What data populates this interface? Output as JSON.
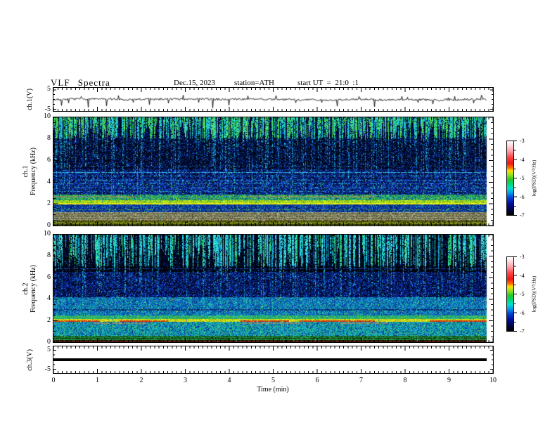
{
  "header": {
    "title": "VLF Spectra",
    "date": "Dec.15, 2023",
    "station": "station=ATH",
    "start_ut": "start UT  =  21:0  :1"
  },
  "axis": {
    "xlabel": "Time (min)",
    "xlim": [
      0,
      10
    ],
    "xticks": [
      "0",
      "1",
      "2",
      "3",
      "4",
      "5",
      "6",
      "7",
      "8",
      "9",
      "10"
    ]
  },
  "colorbar": {
    "label": "log(PSD)(V²/Hz)",
    "ticks": [
      "-3",
      "-4",
      "-5",
      "-6",
      "-7"
    ],
    "range": [
      -3,
      -7
    ],
    "gradient": [
      {
        "c": "#ffffff",
        "p": 0
      },
      {
        "c": "#ffd8dc",
        "p": 6
      },
      {
        "c": "#ff9aa2",
        "p": 14
      },
      {
        "c": "#ff4040",
        "p": 22
      },
      {
        "c": "#f01818",
        "p": 30
      },
      {
        "c": "#ff7000",
        "p": 36
      },
      {
        "c": "#ffe000",
        "p": 40
      },
      {
        "c": "#90e020",
        "p": 46
      },
      {
        "c": "#28c828",
        "p": 52
      },
      {
        "c": "#00d878",
        "p": 58
      },
      {
        "c": "#00e0d0",
        "p": 64
      },
      {
        "c": "#00a0e8",
        "p": 70
      },
      {
        "c": "#0048d8",
        "p": 76
      },
      {
        "c": "#0010a0",
        "p": 84
      },
      {
        "c": "#000450",
        "p": 92
      },
      {
        "c": "#000000",
        "p": 100
      }
    ]
  },
  "chart_data": [
    {
      "id": "ch1-waveform",
      "type": "line",
      "ylabel": "ch.1(V)",
      "ylim": [
        -5,
        5
      ],
      "ytick_labels": [
        "5",
        "-5"
      ],
      "seed": 7,
      "noise_amp": 0.5,
      "data_end_min": 9.86,
      "spikes": [
        [
          0.18,
          -3.2
        ],
        [
          0.34,
          -1.8
        ],
        [
          0.62,
          1.5
        ],
        [
          0.78,
          -4.1
        ],
        [
          1.2,
          -3.4
        ],
        [
          1.47,
          2.0
        ],
        [
          1.8,
          -1.5
        ],
        [
          2.18,
          -2.7
        ],
        [
          2.6,
          -1.9
        ],
        [
          2.95,
          2.2
        ],
        [
          3.3,
          -1.6
        ],
        [
          3.62,
          -4.4
        ],
        [
          3.98,
          -3.1
        ],
        [
          4.42,
          1.8
        ],
        [
          5.05,
          2.0
        ],
        [
          5.5,
          -1.7
        ],
        [
          6.1,
          -1.6
        ],
        [
          6.45,
          -3.5
        ],
        [
          6.95,
          1.5
        ],
        [
          7.3,
          -3.8
        ],
        [
          7.92,
          1.6
        ],
        [
          8.28,
          -1.6
        ],
        [
          8.62,
          -2.4
        ],
        [
          9.12,
          1.6
        ],
        [
          9.55,
          -1.9
        ],
        [
          9.72,
          2.2
        ]
      ]
    },
    {
      "id": "ch1-spectrogram",
      "type": "heatmap",
      "ylabel_line1": "ch.1",
      "ylabel_line2": "Frequency (kHz)",
      "ylim": [
        0,
        10
      ],
      "yticks": [
        "0",
        "2",
        "4",
        "6",
        "8",
        "10"
      ],
      "seed": 42,
      "sferic": {
        "lo": 8.1,
        "density": 0.8,
        "ragged": 1.7,
        "deep_prob": 0.5,
        "penetration": 6.0,
        "full_prob": 0.03,
        "strength": 0.82,
        "palette": [
          "#27c24e",
          "#4ada52",
          "#67e63e",
          "#2bd0bc",
          "#22b2e2",
          "#35e08e",
          "#19c8e8"
        ],
        "pen_palette": [
          "#1b8cc8",
          "#18a6bc",
          "#0e54b4",
          "#2ad2d2"
        ]
      },
      "bands": [
        {
          "hi": 10.01,
          "lo": 8.1,
          "palette": [
            [
              "#000418",
              10
            ],
            [
              "#04156a",
              4
            ],
            [
              "#0a2fa8",
              2
            ],
            [
              "#1244cc",
              1
            ]
          ]
        },
        {
          "hi": 8.1,
          "lo": 5.2,
          "palette": [
            [
              "#000616",
              11
            ],
            [
              "#031252",
              5
            ],
            [
              "#0a2fa8",
              2
            ],
            [
              "#1e56d8",
              1
            ],
            [
              "#17a0c0",
              0.35
            ]
          ]
        },
        {
          "hi": 5.2,
          "lo": 4.3,
          "palette": [
            [
              "#021048",
              7
            ],
            [
              "#0a2fae",
              5
            ],
            [
              "#1e50d8",
              2.5
            ],
            [
              "#24a8cc",
              0.7
            ],
            [
              "#000414",
              4
            ]
          ]
        },
        {
          "hi": 4.3,
          "lo": 2.9,
          "palette": [
            [
              "#03175e",
              7
            ],
            [
              "#0d35bc",
              5
            ],
            [
              "#2258e0",
              2
            ],
            [
              "#22b0b0",
              0.8
            ],
            [
              "#2fc26a",
              0.4
            ],
            [
              "#000414",
              3
            ]
          ]
        },
        {
          "hi": 2.9,
          "lo": 2.35,
          "palette": [
            [
              "#1f9e4e",
              5
            ],
            [
              "#3fc04a",
              4
            ],
            [
              "#22ac96",
              3
            ],
            [
              "#8ccc2c",
              2
            ],
            [
              "#1468b4",
              2
            ],
            [
              "#0a2f90",
              1.5
            ]
          ]
        },
        {
          "hi": 2.35,
          "lo": 1.95,
          "palette": [
            [
              "#a6d414",
              6
            ],
            [
              "#c4e41e",
              4
            ],
            [
              "#7cc830",
              3
            ],
            [
              "#e4e400",
              1.5
            ],
            [
              "#3cb44c",
              2
            ]
          ]
        },
        {
          "hi": 1.95,
          "lo": 1.25,
          "palette": [
            [
              "#0b2f9e",
              6
            ],
            [
              "#1e50cc",
              4
            ],
            [
              "#1aa0bc",
              1.5
            ],
            [
              "#03103e",
              3
            ],
            [
              "#2fb860",
              0.5
            ]
          ]
        },
        {
          "hi": 1.25,
          "lo": 0.55,
          "palette": [
            [
              "#979770",
              8
            ],
            [
              "#a8a884",
              4
            ],
            [
              "#7c7c58",
              4
            ],
            [
              "#b4b494",
              2
            ],
            [
              "#5a5a3c",
              1.5
            ]
          ]
        },
        {
          "hi": 0.55,
          "lo": -0.01,
          "palette": [
            [
              "#15150c",
              9
            ],
            [
              "#2b2b12",
              3
            ],
            [
              "#3c440f",
              1
            ]
          ]
        }
      ],
      "hlines": [
        {
          "f": 5.55,
          "color": "#2a7cc8",
          "prob": 0.3
        },
        {
          "f": 4.95,
          "color": "#34b4da",
          "prob": 0.8
        },
        {
          "f": 4.6,
          "color": "#2fa8d4",
          "prob": 0.45
        },
        {
          "f": 4.25,
          "color": "#2fa8d4",
          "prob": 0.4
        },
        {
          "f": 3.9,
          "color": "#2fa8d4",
          "prob": 0.38
        },
        {
          "f": 3.52,
          "color": "#2fa8d4",
          "prob": 0.35
        },
        {
          "f": 3.17,
          "color": "#2fa8d4",
          "prob": 0.33
        },
        {
          "f": 2.7,
          "color": "#8e8e62",
          "prob": 0.75,
          "th": 2,
          "segs": [
            [
              0,
              1.85
            ],
            [
              4.3,
              7.3
            ]
          ]
        },
        {
          "f": 2.05,
          "color": "#e2ee16",
          "prob": 0.95,
          "th": 2
        },
        {
          "f": 1.52,
          "color": "#63b431",
          "prob": 0.4
        },
        {
          "f": 1.1,
          "color": "#3a3a22",
          "prob": 0.85
        },
        {
          "f": 0.9,
          "color": "#34341e",
          "prob": 0.85
        },
        {
          "f": 0.72,
          "color": "#42422a",
          "prob": 0.8
        },
        {
          "f": 0.52,
          "color": "#c24ec2",
          "prob": 0.2
        },
        {
          "f": 0.45,
          "color": "#b2ca16",
          "prob": 0.9
        },
        {
          "f": 0.3,
          "color": "#94aa12",
          "prob": 0.85
        },
        {
          "f": 0.18,
          "color": "#c2d41e",
          "prob": 0.9
        },
        {
          "f": 0.06,
          "color": "#6a7c0c",
          "prob": 0.9
        }
      ]
    },
    {
      "id": "ch2-spectrogram",
      "type": "heatmap",
      "ylabel_line1": "ch.2",
      "ylabel_line2": "Frequency (kHz)",
      "ylim": [
        0,
        10
      ],
      "yticks": [
        "0",
        "2",
        "4",
        "6",
        "8",
        "10"
      ],
      "seed": 1337,
      "sferic": {
        "lo": 7.1,
        "density": 0.55,
        "ragged": 2.0,
        "deep_prob": 0.45,
        "penetration": 5.5,
        "full_prob": 0.05,
        "strength": 0.85,
        "palette": [
          "#1fd2d2",
          "#3ce4e4",
          "#17a0dc",
          "#2de088",
          "#55eeee",
          "#18c8f0",
          "#2cc84e"
        ],
        "pen_palette": [
          "#17a0c8",
          "#14b4b4",
          "#0c50b4",
          "#27d2d2"
        ]
      },
      "bands": [
        {
          "hi": 10.01,
          "lo": 7.1,
          "palette": [
            [
              "#00030e",
              12
            ],
            [
              "#021048",
              3
            ],
            [
              "#0a2fa8",
              1.2
            ],
            [
              "#0c86c6",
              0.5
            ]
          ]
        },
        {
          "hi": 7.1,
          "lo": 6.6,
          "palette": [
            [
              "#000208",
              12
            ],
            [
              "#021048",
              2
            ],
            [
              "#0a2fa8",
              0.8
            ]
          ]
        },
        {
          "hi": 6.6,
          "lo": 4.2,
          "palette": [
            [
              "#020c3c",
              8
            ],
            [
              "#0a2aaa",
              5
            ],
            [
              "#1c4cd4",
              2
            ],
            [
              "#1c96cc",
              0.8
            ],
            [
              "#000310",
              4
            ]
          ]
        },
        {
          "hi": 4.2,
          "lo": 2.5,
          "palette": [
            [
              "#0f86c4",
              5
            ],
            [
              "#17a8ac",
              4
            ],
            [
              "#0b50bc",
              4
            ],
            [
              "#2cc488",
              1.5
            ],
            [
              "#0a2f8e",
              3
            ],
            [
              "#d4d41c",
              0.15
            ]
          ]
        },
        {
          "hi": 2.5,
          "lo": 2.18,
          "palette": [
            [
              "#26ac5c",
              5
            ],
            [
              "#1fb894",
              3
            ],
            [
              "#62c434",
              3
            ],
            [
              "#118cb4",
              2
            ]
          ]
        },
        {
          "hi": 2.18,
          "lo": 1.92,
          "palette": [
            [
              "#e0dc10",
              6
            ],
            [
              "#f4cc0e",
              3
            ],
            [
              "#aad818",
              3
            ],
            [
              "#84ca24",
              2
            ]
          ]
        },
        {
          "hi": 1.92,
          "lo": 0.6,
          "palette": [
            [
              "#129ec2",
              5
            ],
            [
              "#1cb4a4",
              4
            ],
            [
              "#0b52b4",
              3
            ],
            [
              "#2cc47c",
              2
            ],
            [
              "#0a2f86",
              2
            ],
            [
              "#62c434",
              0.6
            ]
          ]
        },
        {
          "hi": 0.6,
          "lo": 0.22,
          "palette": [
            [
              "#21963e",
              5
            ],
            [
              "#33b252",
              3
            ],
            [
              "#156e2c",
              3
            ],
            [
              "#0c3c16",
              2
            ]
          ]
        },
        {
          "hi": 0.22,
          "lo": -0.01,
          "palette": [
            [
              "#0e0e06",
              8
            ],
            [
              "#222410",
              3
            ]
          ]
        }
      ],
      "hlines": [
        {
          "f": 6.85,
          "color": "#1e50c8",
          "prob": 0.5
        },
        {
          "f": 3.07,
          "color": "#0d2464",
          "prob": 0.6,
          "th": 2
        },
        {
          "f": 2.05,
          "color": "#d83410",
          "prob": 0.9,
          "th": 2,
          "segs": [
            [
              0,
              1.05
            ],
            [
              1.5,
              2.6
            ],
            [
              4.25,
              5.35
            ],
            [
              5.6,
              7.3
            ],
            [
              8.55,
              9.85
            ]
          ]
        },
        {
          "f": 1.83,
          "color": "#8e8e74",
          "prob": 0.8,
          "th": 2,
          "segs": [
            [
              0.9,
              2.1
            ],
            [
              4.3,
              5.6
            ],
            [
              6.5,
              7.6
            ]
          ]
        },
        {
          "f": 0.5,
          "color": "#123c12",
          "prob": 0.8
        },
        {
          "f": 0.36,
          "color": "#0c300c",
          "prob": 0.8
        },
        {
          "f": 0.12,
          "color": "#a62c16",
          "prob": 0.9
        },
        {
          "f": 0.03,
          "color": "#050503",
          "prob": 0.95
        }
      ]
    },
    {
      "id": "ch3-trace",
      "type": "line",
      "ylabel": "ch.3(V)",
      "ytick_labels": [
        "5",
        "-5"
      ],
      "value": 0,
      "line_thickness_px": 4,
      "data_end_min": 9.86,
      "color": "#000000"
    }
  ]
}
